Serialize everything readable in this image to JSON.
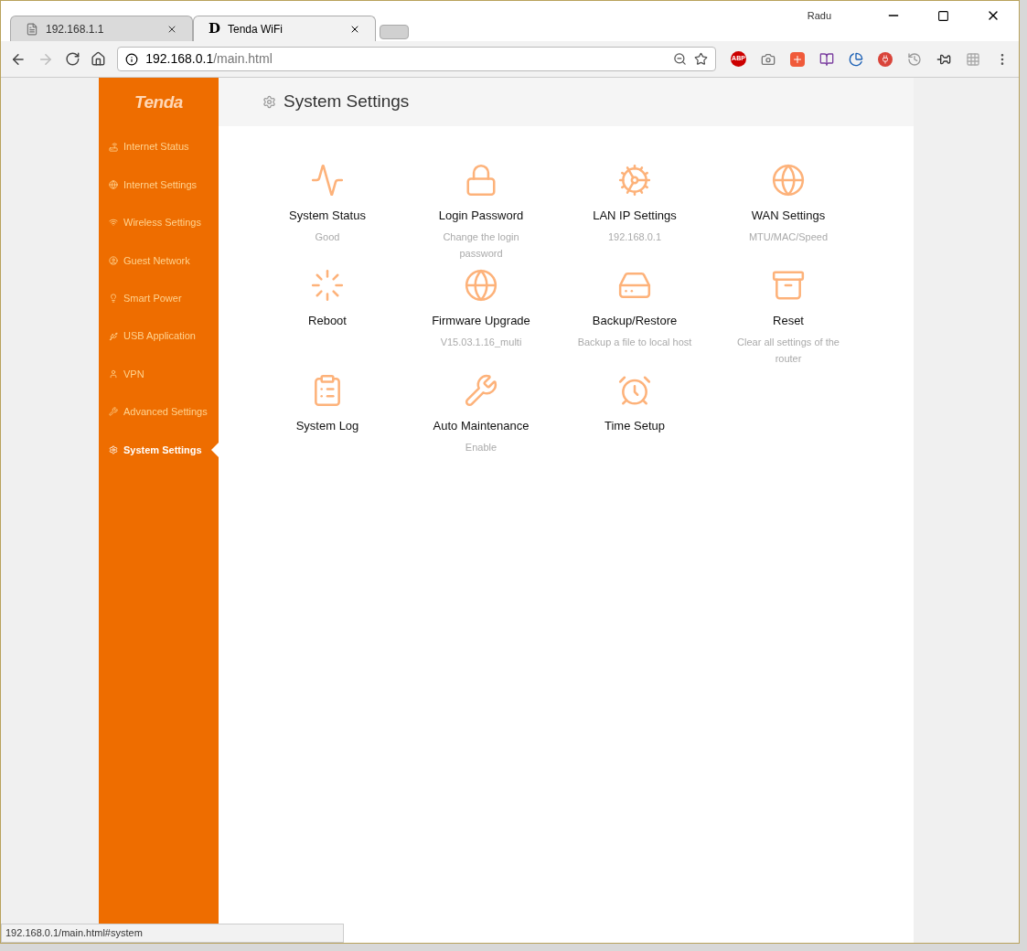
{
  "browser": {
    "tabs": [
      {
        "title": "192.168.1.1",
        "kind": "page",
        "selected": false
      },
      {
        "title": "Tenda WiFi",
        "kind": "logo",
        "logo_letter": "D",
        "selected": true
      }
    ],
    "user": "Radu",
    "address": {
      "host": "192.168.0.1",
      "path": "/main.html"
    },
    "extension_label": "ABP"
  },
  "sidebar": {
    "logo": "Tenda",
    "items": [
      {
        "label": "Internet Status",
        "kind": "router",
        "selected": false
      },
      {
        "label": "Internet Settings",
        "kind": "globe",
        "selected": false
      },
      {
        "label": "Wireless Settings",
        "kind": "wifi",
        "selected": false
      },
      {
        "label": "Guest Network",
        "kind": "guest",
        "selected": false
      },
      {
        "label": "Smart Power",
        "kind": "bulb",
        "selected": false
      },
      {
        "label": "USB Application",
        "kind": "usb",
        "selected": false
      },
      {
        "label": "VPN",
        "kind": "vpn",
        "selected": false
      },
      {
        "label": "Advanced Settings",
        "kind": "wrench",
        "selected": false
      },
      {
        "label": "System Settings",
        "kind": "gear",
        "selected": true
      }
    ]
  },
  "page": {
    "title": "System Settings",
    "tiles": [
      {
        "title": "System Status",
        "subtitle": "Good",
        "kind": "status"
      },
      {
        "title": "Login Password",
        "subtitle": "Change the login password",
        "kind": "password"
      },
      {
        "title": "LAN IP Settings",
        "subtitle": "192.168.0.1",
        "kind": "lan"
      },
      {
        "title": "WAN Settings",
        "subtitle": "MTU/MAC/Speed",
        "kind": "wan"
      },
      {
        "title": "Reboot",
        "kind": "reboot"
      },
      {
        "title": "Firmware Upgrade",
        "subtitle": "V15.03.1.16_multi",
        "kind": "firmware"
      },
      {
        "title": "Backup/Restore",
        "subtitle": "Backup a file to local host",
        "kind": "backup"
      },
      {
        "title": "Reset",
        "subtitle": "Clear all settings of the router",
        "kind": "reset"
      },
      {
        "title": "System Log",
        "kind": "log"
      },
      {
        "title": "Auto Maintenance",
        "subtitle": "Enable",
        "kind": "maintenance"
      },
      {
        "title": "Time Setup",
        "kind": "time"
      }
    ]
  },
  "status_bar": "192.168.0.1/main.html#system"
}
